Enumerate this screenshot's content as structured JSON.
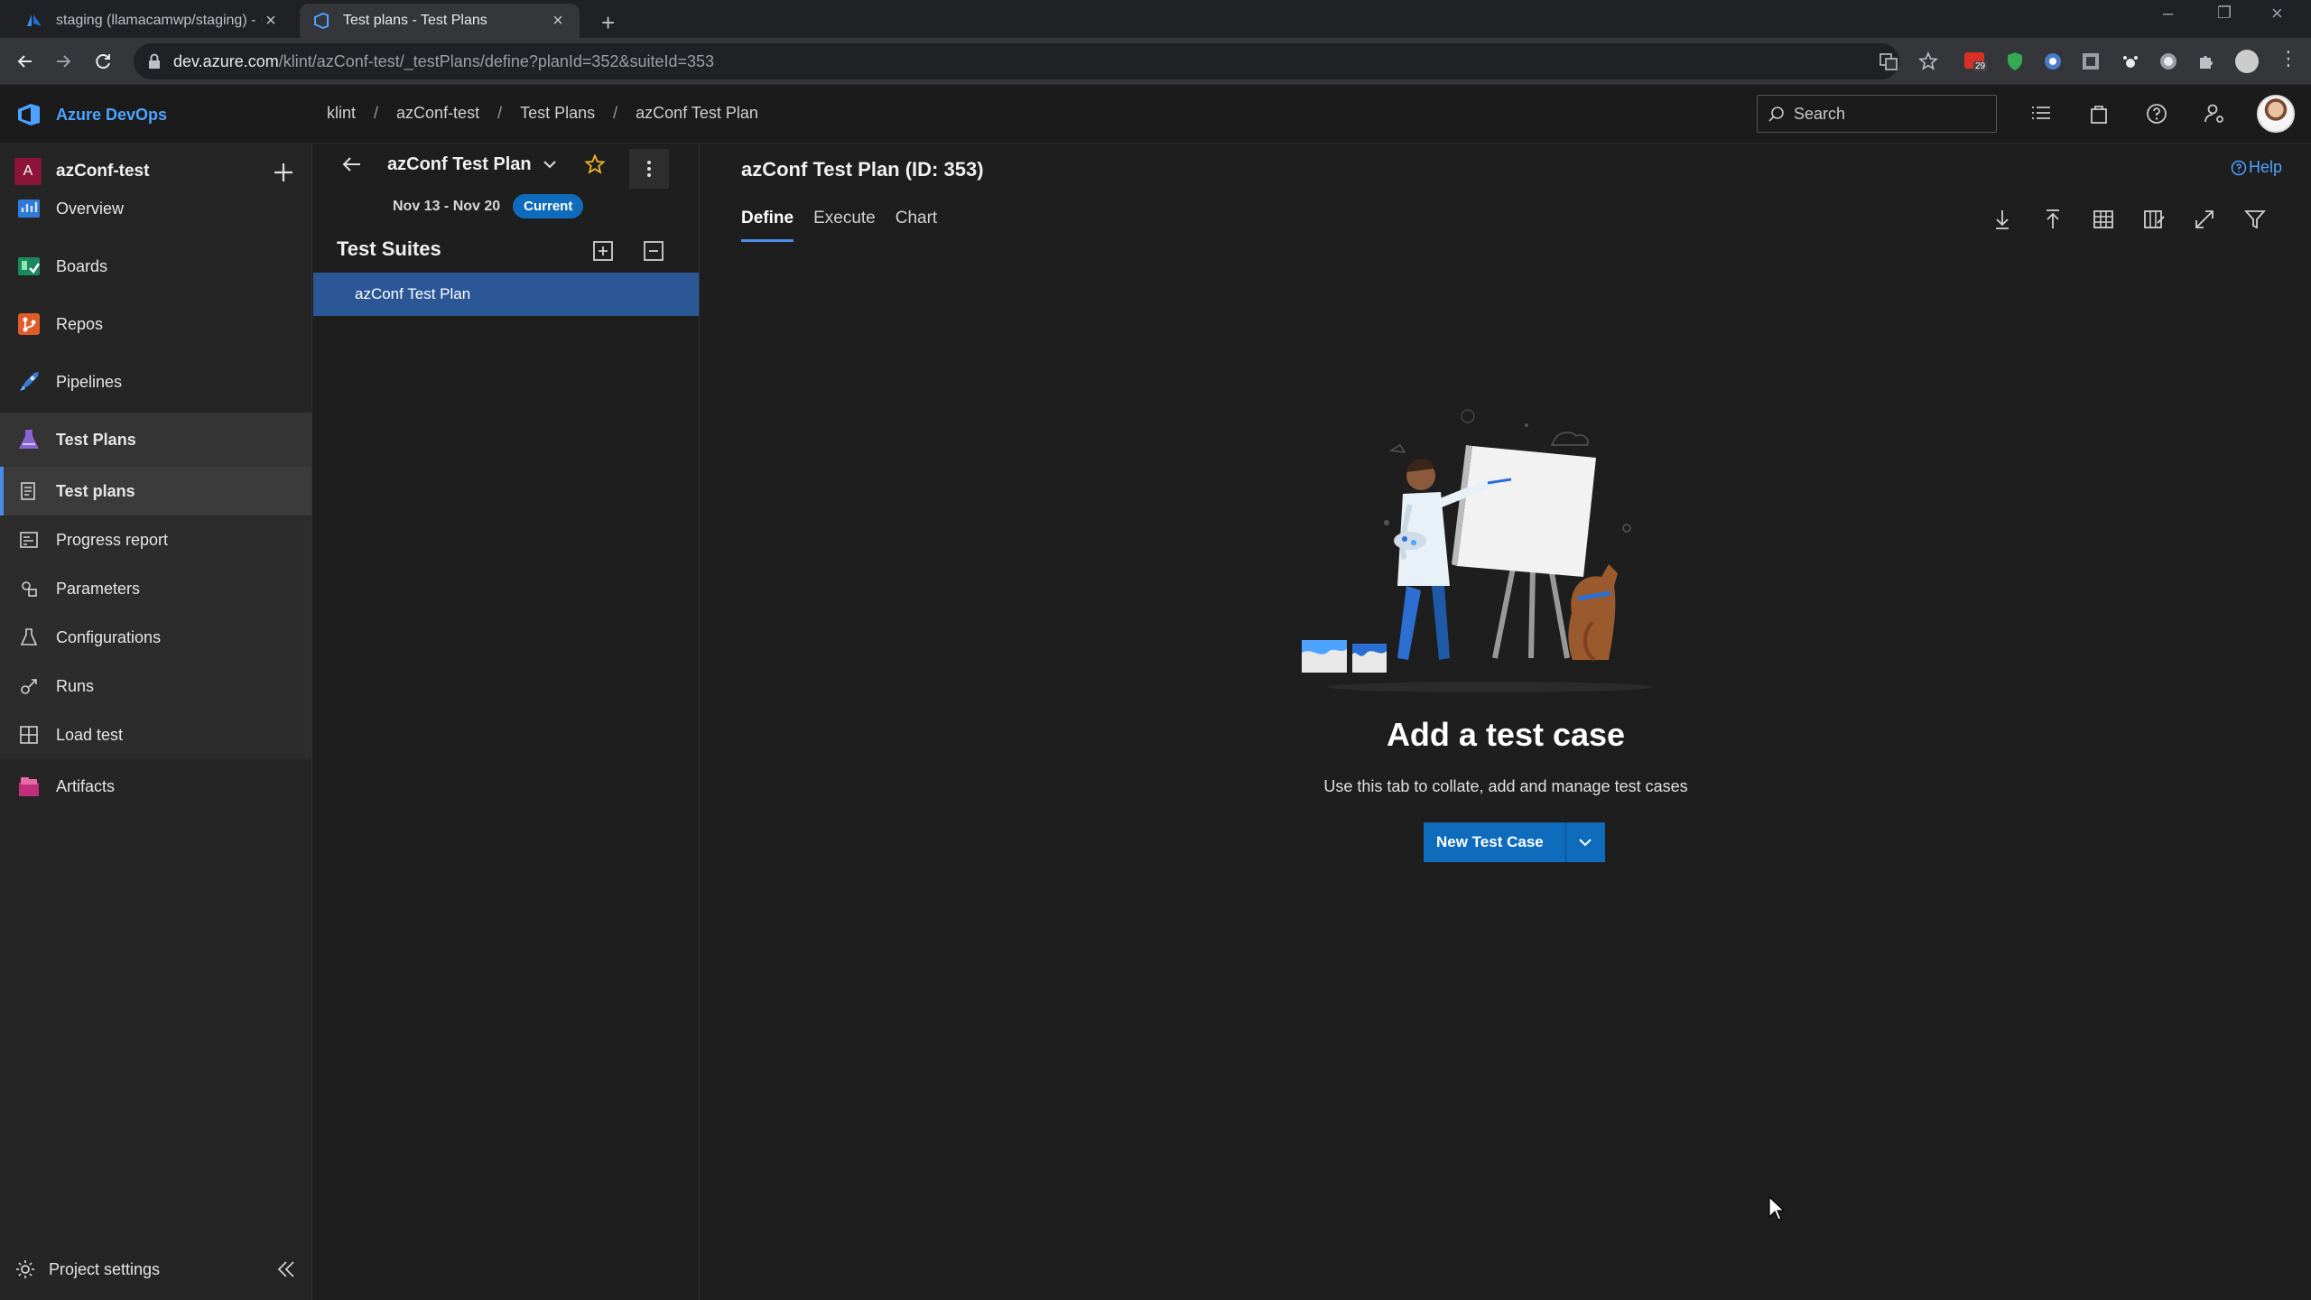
{
  "browser": {
    "tabs": [
      {
        "title": "staging (llamacamwp/staging) - ·",
        "active": false
      },
      {
        "title": "Test plans - Test Plans",
        "active": true
      }
    ],
    "url_host": "dev.azure.com",
    "url_path": "/klint/azConf-test/_testPlans/define?planId=352&suiteId=353",
    "extension_badge": "29"
  },
  "header": {
    "brand": "Azure DevOps",
    "breadcrumb": [
      "klint",
      "azConf-test",
      "Test Plans",
      "azConf Test Plan"
    ],
    "search_placeholder": "Search"
  },
  "sidebar": {
    "project_initial": "A",
    "project_name": "azConf-test",
    "items": [
      {
        "label": "Overview",
        "icon": "overview-icon"
      },
      {
        "label": "Boards",
        "icon": "boards-icon"
      },
      {
        "label": "Repos",
        "icon": "repos-icon"
      },
      {
        "label": "Pipelines",
        "icon": "pipelines-icon"
      },
      {
        "label": "Test Plans",
        "icon": "test-plans-icon"
      }
    ],
    "subitems": [
      {
        "label": "Test plans",
        "icon": "test-plans-list-icon"
      },
      {
        "label": "Progress report",
        "icon": "progress-report-icon"
      },
      {
        "label": "Parameters",
        "icon": "parameters-icon"
      },
      {
        "label": "Configurations",
        "icon": "configurations-icon"
      },
      {
        "label": "Runs",
        "icon": "runs-icon"
      },
      {
        "label": "Load test",
        "icon": "load-test-icon"
      }
    ],
    "artifacts": {
      "label": "Artifacts",
      "icon": "artifacts-icon"
    },
    "project_settings": "Project settings"
  },
  "suites": {
    "plan_name": "azConf Test Plan",
    "dates": "Nov 13 - Nov 20",
    "status": "Current",
    "title": "Test Suites",
    "items": [
      "azConf Test Plan"
    ]
  },
  "main": {
    "title": "azConf Test Plan (ID: 353)",
    "help": "Help",
    "tabs": [
      "Define",
      "Execute",
      "Chart"
    ],
    "empty_title": "Add a test case",
    "empty_desc": "Use this tab to collate, add and manage test cases",
    "new_button": "New Test Case"
  },
  "colors": {
    "accent": "#0f6cbd",
    "link": "#4da3ff",
    "selected_row": "#2b5797"
  }
}
